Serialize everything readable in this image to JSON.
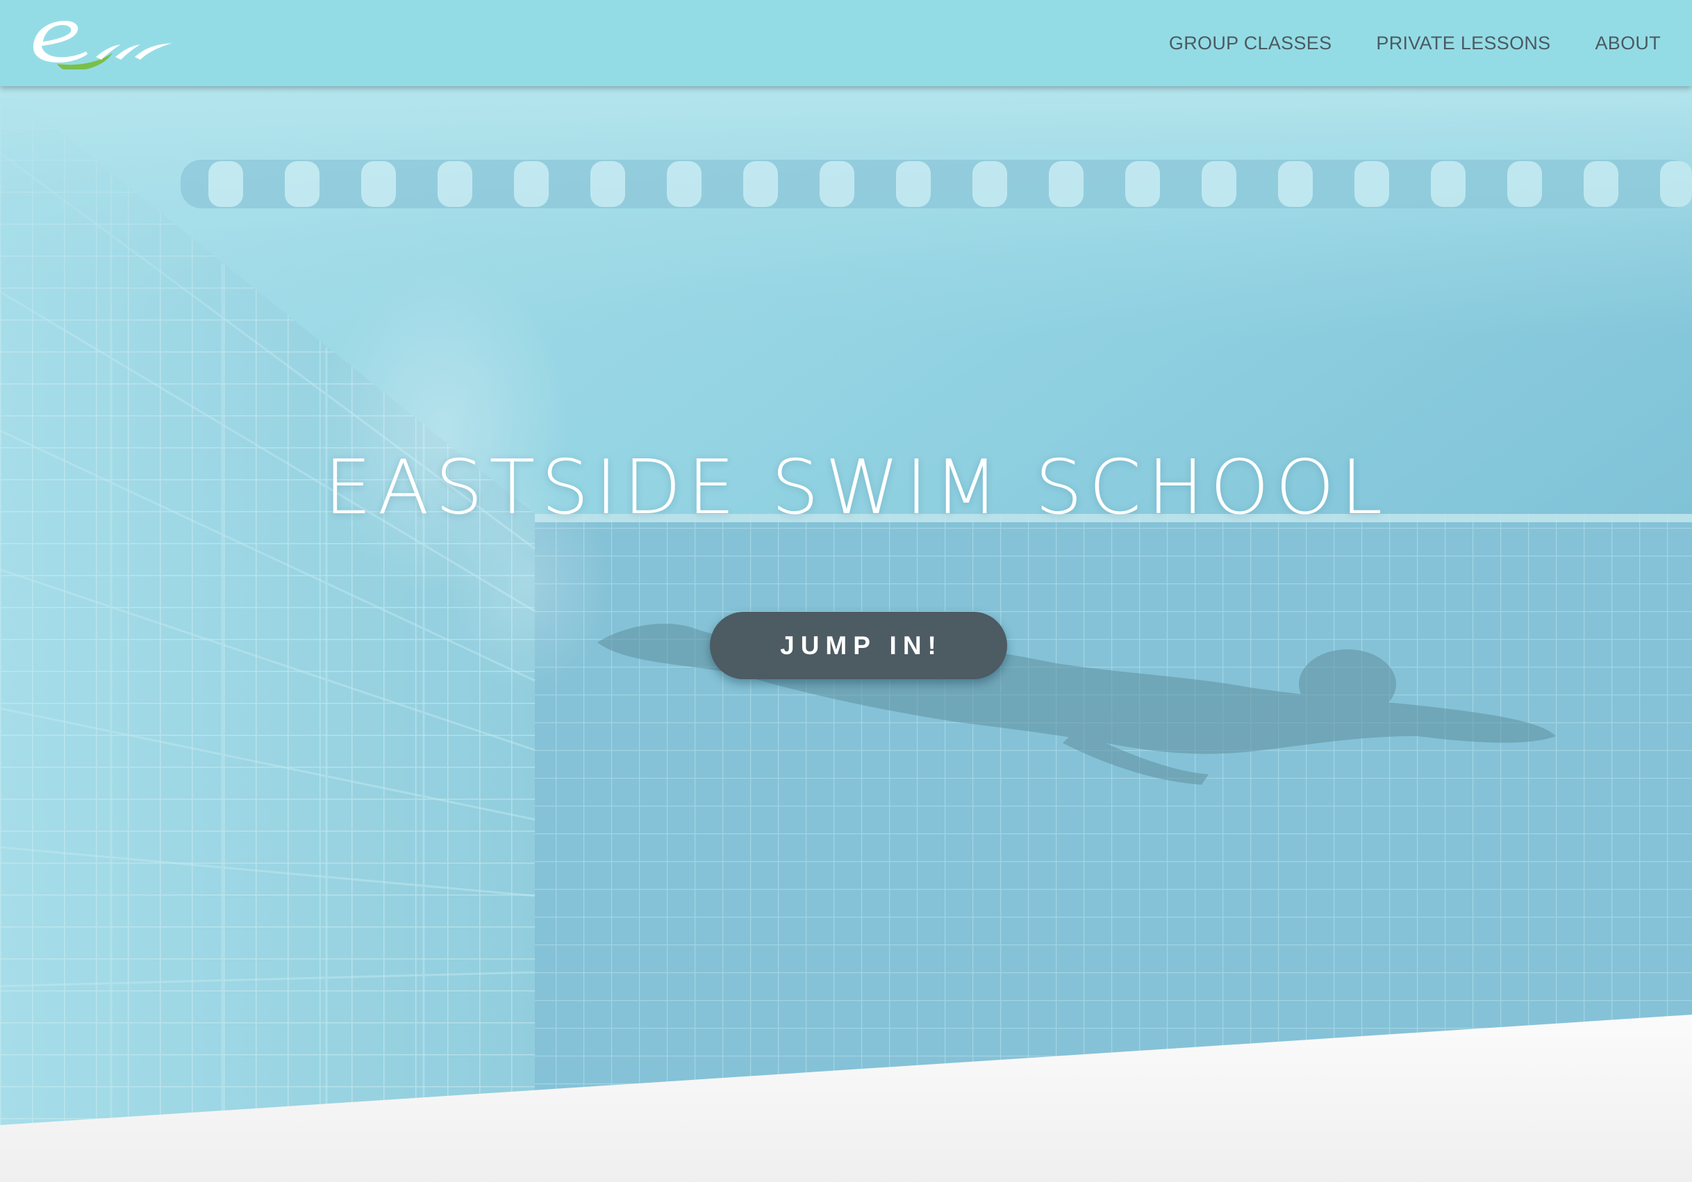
{
  "site": {
    "logo_alt": "eswim logo",
    "colors": {
      "navbar_bg": "#94dce5",
      "nav_text": "#4a5a62",
      "cta_bg": "#4d5b63",
      "water_light": "#a9e2ec",
      "water_dark": "#64abc8",
      "logo_white": "#ffffff",
      "logo_green": "#7bbf4a"
    }
  },
  "nav": {
    "links": [
      {
        "label": "GROUP CLASSES"
      },
      {
        "label": "PRIVATE LESSONS"
      },
      {
        "label": "ABOUT"
      }
    ]
  },
  "hero": {
    "title": "EASTSIDE SWIM SCHOOL",
    "cta_label": "JUMP IN!"
  }
}
